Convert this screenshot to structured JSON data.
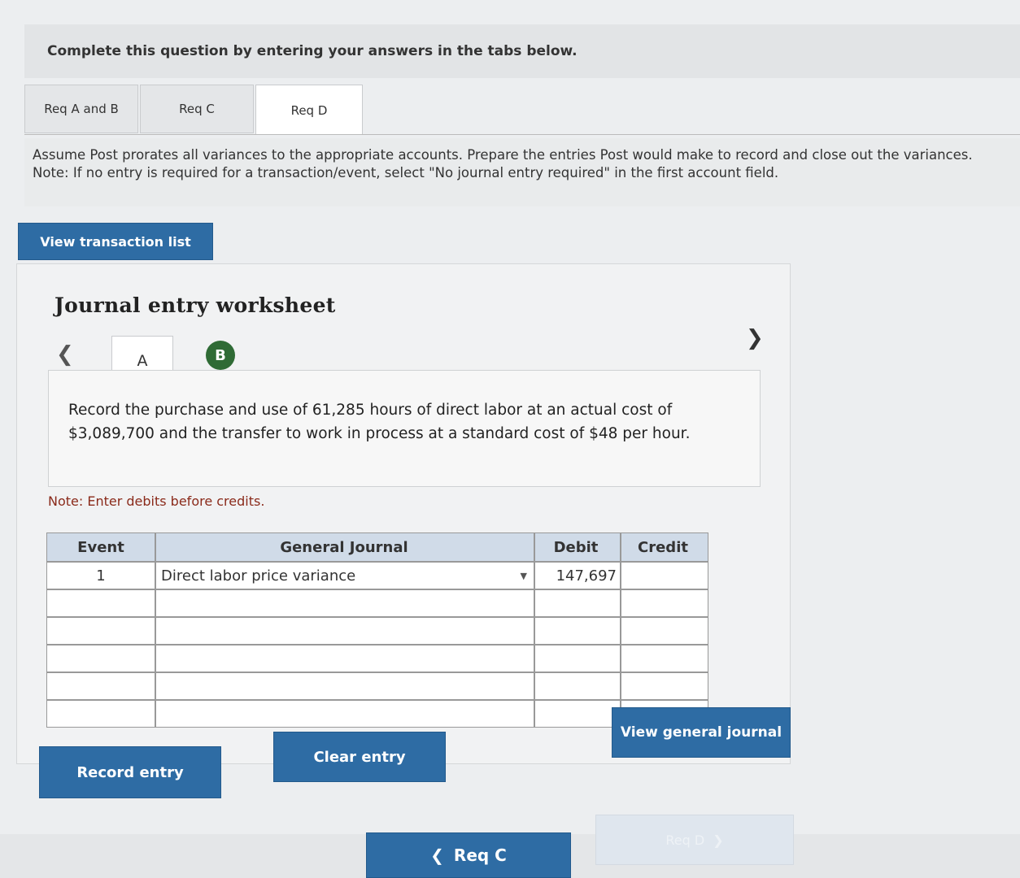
{
  "header": {
    "title": "Complete this question by entering your answers in the tabs below."
  },
  "tabs": [
    {
      "label": "Req A and B"
    },
    {
      "label": "Req C"
    },
    {
      "label": "Req D"
    }
  ],
  "instructions": {
    "main": "Assume Post prorates all variances to the appropriate accounts. Prepare the entries Post would make to record and close out the variances.",
    "note": "Note: If no entry is required for a transaction/event, select \"No journal entry required\" in the first account field."
  },
  "buttons": {
    "view_transaction_list": "View transaction list",
    "record_entry": "Record entry",
    "clear_entry": "Clear entry",
    "view_general_journal": "View general journal",
    "prev_req": "Req C",
    "next_req": "Req D"
  },
  "worksheet": {
    "title": "Journal entry worksheet",
    "entry_tabs": [
      "A",
      "B"
    ],
    "description": "Record the purchase and use of 61,285 hours of direct labor at an actual cost of $3,089,700 and the transfer to work in process at a standard cost of $48 per hour.",
    "note": "Note: Enter debits before credits."
  },
  "journal": {
    "headers": {
      "event": "Event",
      "account": "General Journal",
      "debit": "Debit",
      "credit": "Credit"
    },
    "rows": [
      {
        "event": "1",
        "account": "Direct labor price variance",
        "debit": "147,697",
        "credit": ""
      },
      {
        "event": "",
        "account": "",
        "debit": "",
        "credit": ""
      },
      {
        "event": "",
        "account": "",
        "debit": "",
        "credit": ""
      },
      {
        "event": "",
        "account": "",
        "debit": "",
        "credit": ""
      },
      {
        "event": "",
        "account": "",
        "debit": "",
        "credit": ""
      },
      {
        "event": "",
        "account": "",
        "debit": "",
        "credit": ""
      }
    ]
  }
}
